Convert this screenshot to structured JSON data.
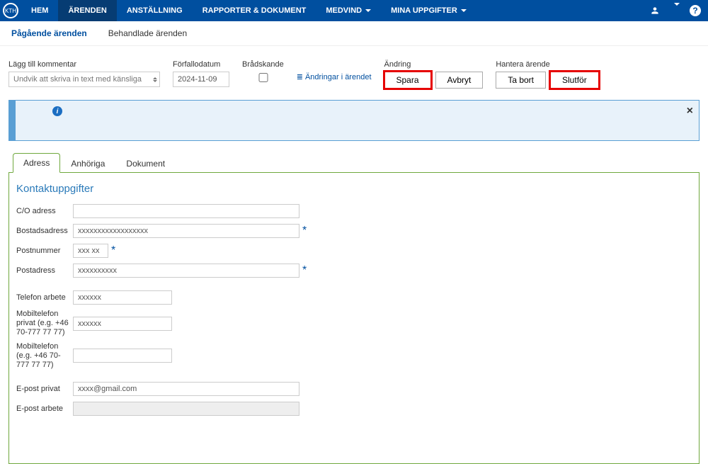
{
  "logo_text": "KTH",
  "nav": {
    "items": [
      {
        "label": "HEM",
        "has_caret": false,
        "active": false
      },
      {
        "label": "ÄRENDEN",
        "has_caret": false,
        "active": true
      },
      {
        "label": "ANSTÄLLNING",
        "has_caret": false,
        "active": false
      },
      {
        "label": "RAPPORTER & DOKUMENT",
        "has_caret": false,
        "active": false
      },
      {
        "label": "MEDVIND",
        "has_caret": true,
        "active": false
      },
      {
        "label": "MINA UPPGIFTER",
        "has_caret": true,
        "active": false
      }
    ]
  },
  "subnav": {
    "items": [
      {
        "label": "Pågående ärenden",
        "active": true
      },
      {
        "label": "Behandlade ärenden",
        "active": false
      }
    ]
  },
  "toolbar": {
    "comment_label": "Lägg till kommentar",
    "comment_placeholder": "Undvik att skriva in text med känsliga",
    "due_label": "Förfallodatum",
    "due_value": "2024-11-09",
    "urgent_label": "Brådskande",
    "changes_link": "Ändringar i ärendet",
    "change_label": "Ändring",
    "save_label": "Spara",
    "cancel_label": "Avbryt",
    "manage_label": "Hantera ärende",
    "delete_label": "Ta bort",
    "finish_label": "Slutför"
  },
  "tabs": [
    {
      "label": "Adress",
      "active": true
    },
    {
      "label": "Anhöriga",
      "active": false
    },
    {
      "label": "Dokument",
      "active": false
    }
  ],
  "contact": {
    "section_title": "Kontaktuppgifter",
    "co_label": "C/O adress",
    "co_value": "",
    "home_label": "Bostadsadress",
    "home_value": "xxxxxxxxxxxxxxxxxx",
    "post_label": "Postnummer",
    "post_value": "xxx xx",
    "postaddr_label": "Postadress",
    "postaddr_value": "xxxxxxxxxx",
    "tel_work_label": "Telefon arbete",
    "tel_work_value": "xxxxxx",
    "mobile_priv_label": "Mobiltelefon privat (e.g. +46 70-777 77 77)",
    "mobile_priv_value": "xxxxxx",
    "mobile_label": "Mobiltelefon (e.g. +46 70-777 77 77)",
    "mobile_value": "",
    "email_priv_label": "E-post privat",
    "email_priv_value": "xxxx@gmail.com",
    "email_work_label": "E-post arbete"
  }
}
